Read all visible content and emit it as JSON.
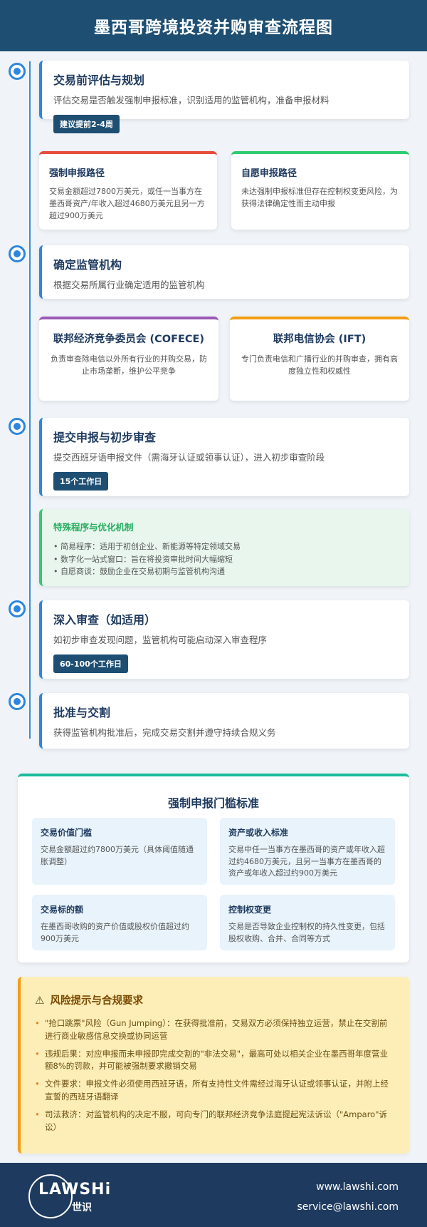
{
  "title": "墨西哥跨境投资并购审查流程图",
  "steps": [
    {
      "title": "交易前评估与规划",
      "desc": "评估交易是否触发强制申报标准，识别适用的监管机构，准备申报材料",
      "badge": "建议提前2-4周"
    },
    {
      "title": "确定监管机构",
      "desc": "根据交易所属行业确定适用的监管机构"
    },
    {
      "title": "提交申报与初步审查",
      "desc": "提交西班牙语申报文件（需海牙认证或领事认证），进入初步审查阶段",
      "badge": "15个工作日"
    },
    {
      "title": "深入审查（如适用）",
      "desc": "如初步审查发现问题，监管机构可能启动深入审查程序",
      "badge": "60-100个工作日"
    },
    {
      "title": "批准与交割",
      "desc": "获得监管机构批准后，完成交易交割并遵守持续合规义务"
    }
  ],
  "paths": [
    {
      "title": "强制申报路径",
      "desc": "交易金额超过7800万美元，或任一当事方在墨西哥资产/年收入超过4680万美元且另一方超过900万美元"
    },
    {
      "title": "自愿申报路径",
      "desc": "未达强制申报标准但存在控制权变更风险，为获得法律确定性而主动申报"
    }
  ],
  "agencies": [
    {
      "title": "联邦经济竞争委员会 (COFECE)",
      "desc": "负责审查除电信以外所有行业的并购交易，防止市场垄断，维护公平竞争"
    },
    {
      "title": "联邦电信协会 (IFT)",
      "desc": "专门负责电信和广播行业的并购审查，拥有高度独立性和权威性"
    }
  ],
  "special": {
    "title": "特殊程序与优化机制",
    "items": [
      "简易程序：适用于初创企业、新能源等特定领域交易",
      "数字化一站式窗口：旨在将投资审批时间大幅缩短",
      "自愿商谈：鼓励企业在交易初期与监管机构沟通"
    ]
  },
  "threshold": {
    "title": "强制申报门槛标准",
    "items": [
      {
        "title": "交易价值门槛",
        "desc": "交易金额超过约7800万美元（具体阈值随通胀调整）"
      },
      {
        "title": "资产或收入标准",
        "desc": "交易中任一当事方在墨西哥的资产或年收入超过约4680万美元，且另一当事方在墨西哥的资产或年收入超过约900万美元"
      },
      {
        "title": "交易标的额",
        "desc": "在墨西哥收购的资产价值或股权价值超过约900万美元"
      },
      {
        "title": "控制权变更",
        "desc": "交易是否导致企业控制权的持久性变更，包括股权收购、合并、合同等方式"
      }
    ]
  },
  "risk": {
    "title": "风险提示与合规要求",
    "icon": "warning-icon",
    "items": [
      "\"抢口跳票\"风险（Gun Jumping）：在获得批准前，交易双方必须保持独立运营，禁止在交割前进行商业敏感信息交换或协同运营",
      "违规后果：对应申报而未申报即完成交割的\"非法交易\"，最高可处以相关企业在墨西哥年度营业额8%的罚款，并可能被强制要求撤销交易",
      "文件要求：申报文件必须使用西班牙语，所有支持性文件需经过海牙认证或领事认证，并附上经宣誓的西班牙语翻译",
      "司法救济：对监管机构的决定不服，可向专门的联邦经济竞争法庭提起宪法诉讼（\"Amparo\"诉讼）"
    ]
  },
  "footer": {
    "logo_text": "LAWSHi",
    "logo_sub": "世识",
    "website": "www.lawshi.com",
    "email": "service@lawshi.com"
  },
  "colors": {
    "header": "#1e4f73",
    "accent": "#2e86de",
    "footer": "#1e3a5f"
  }
}
